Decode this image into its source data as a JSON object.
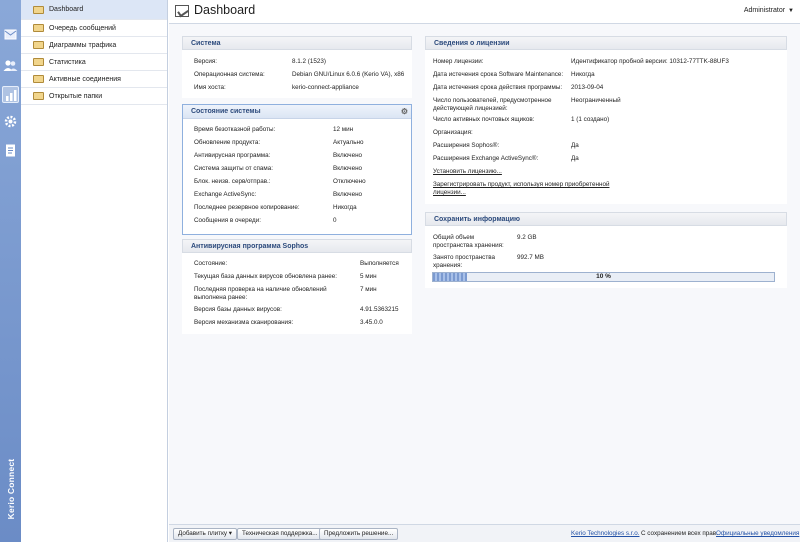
{
  "header": {
    "title": "Dashboard",
    "user": "Administrator"
  },
  "brand": "Kerio Connect",
  "rail": [
    "mail-icon",
    "users-icon",
    "dashboard-chart-icon",
    "gear-icon",
    "document-icon"
  ],
  "nav": [
    {
      "label": "Dashboard",
      "active": true
    },
    {
      "label": "Очередь сообщений"
    },
    {
      "label": "Диаграммы трафика"
    },
    {
      "label": "Статистика"
    },
    {
      "label": "Активные соединения"
    },
    {
      "label": "Открытые папки"
    }
  ],
  "system": {
    "title": "Система",
    "rows": [
      {
        "k": "Версия:",
        "v": "8.1.2 (1523)"
      },
      {
        "k": "Операционная система:",
        "v": "Debian GNU/Linux 6.0.6 (Kerio VA), x86"
      },
      {
        "k": "Имя хоста:",
        "v": "kerio-connect-appliance"
      }
    ]
  },
  "status": {
    "title": "Состояние системы",
    "rows": [
      {
        "k": "Время безотказной работы:",
        "v": "12 мин"
      },
      {
        "k": "Обновление продукта:",
        "v": "Актуально"
      },
      {
        "k": "Антивирусная программа:",
        "v": "Включено"
      },
      {
        "k": "Система защиты от спама:",
        "v": "Включено"
      },
      {
        "k": "Блок. неизв. серв/отправ.:",
        "v": "Отключено"
      },
      {
        "k": "Exchange ActiveSync:",
        "v": "Включено"
      },
      {
        "k": "Последнее резервное копирование:",
        "v": "Никогда"
      },
      {
        "k": "Сообщения в очереди:",
        "v": "0"
      }
    ]
  },
  "sophos": {
    "title": "Антивирусная программа Sophos",
    "rows": [
      {
        "k": "Состояние:",
        "v": "Выполняется"
      },
      {
        "k": "Текущая база данных вирусов обновлена ранее:",
        "v": "5 мин"
      },
      {
        "k": "Последняя проверка на наличие обновлений выполнена ранее:",
        "v": "7 мин"
      },
      {
        "k": "Версия базы данных вирусов:",
        "v": "4.91.5363215"
      },
      {
        "k": "Версия механизма сканирования:",
        "v": "3.45.0.0"
      }
    ]
  },
  "license": {
    "title": "Сведения о лицензии",
    "rows": [
      {
        "k": "Номер лицензии:",
        "v": "Идентификатор пробной версии: 10312-77TTK-88UF3"
      },
      {
        "k": "Дата истечения срока Software Maintenance:",
        "v": "Никогда"
      },
      {
        "k": "Дата истечения срока действия программы:",
        "v": "2013-09-04"
      },
      {
        "k": "Число пользователей, предусмотренное действующей лицензией:",
        "v": "Неограниченный"
      },
      {
        "k": "Число активных почтовых ящиков:",
        "v": "1 (1 создано)"
      },
      {
        "k": "Организация:",
        "v": ""
      },
      {
        "k": "Расширения Sophos®:",
        "v": "Да"
      },
      {
        "k": "Расширения Exchange ActiveSync®:",
        "v": "Да"
      }
    ],
    "link_install": "Установить лицензию...",
    "link_register": "Зарегистрировать продукт, используя номер приобретенной лицензии..."
  },
  "storage": {
    "title": "Сохранить информацию",
    "total_label": "Общий объем пространства хранения:",
    "total_value": "9.2 GB",
    "used_label": "Занято пространства хранения:",
    "used_value": "992.7 MB",
    "percent_text": "10 %",
    "percent": 0.1
  },
  "footer": {
    "add_tile": "Добавить плитку ▾",
    "support": "Техническая поддержка...",
    "suggest": "Предложить решение...",
    "company": "Kerio Technologies s.r.o.",
    "rights": "С сохранением всех прав.",
    "legal": "Официальные уведомления"
  }
}
